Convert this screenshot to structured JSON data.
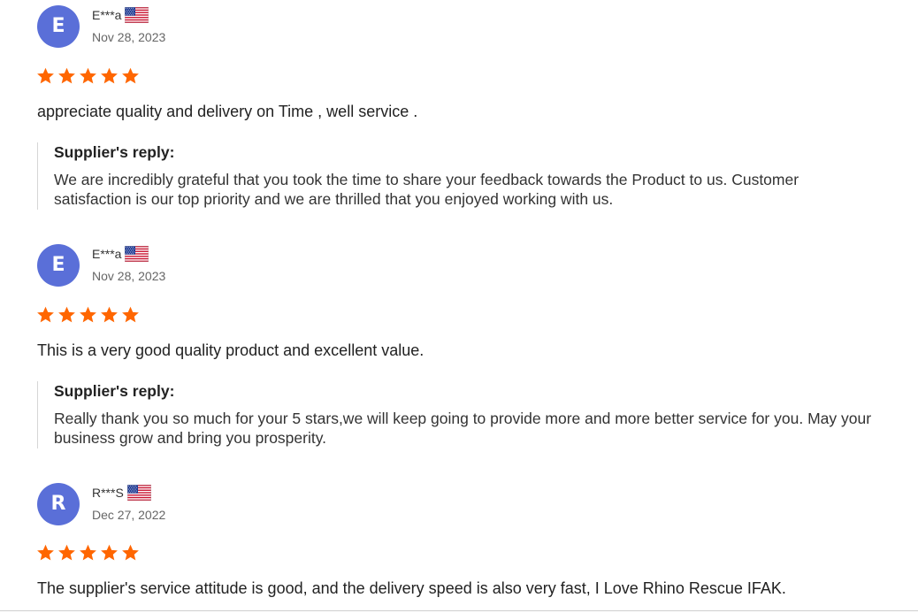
{
  "colors": {
    "avatar_bg": "#5a6fd8",
    "star": "#ff6600",
    "reply_border": "#d6d6d6"
  },
  "reviews": [
    {
      "avatar_letter": "E",
      "username": "E***a",
      "country_flag": "us-flag-icon",
      "date": "Nov 28, 2023",
      "rating": 5,
      "comment": "appreciate quality and delivery on Time , well service .",
      "reply": {
        "title": "Supplier's reply:",
        "text": "We are incredibly grateful that you took the time to share your feedback towards the Product to us. Customer satisfaction is our top priority and we are thrilled that you enjoyed working with us."
      }
    },
    {
      "avatar_letter": "E",
      "username": "E***a",
      "country_flag": "us-flag-icon",
      "date": "Nov 28, 2023",
      "rating": 5,
      "comment": "This is a very good quality product and excellent value.",
      "reply": {
        "title": "Supplier's reply:",
        "text": "Really thank you so much for your 5 stars,we will keep going to provide more and more better service for you. May your business grow and bring you prosperity."
      }
    },
    {
      "avatar_letter": "R",
      "username": "R***S",
      "country_flag": "us-flag-icon",
      "date": "Dec 27, 2022",
      "rating": 5,
      "comment": "The supplier's service attitude is good, and the delivery speed is also very fast, I Love Rhino Rescue IFAK."
    }
  ]
}
